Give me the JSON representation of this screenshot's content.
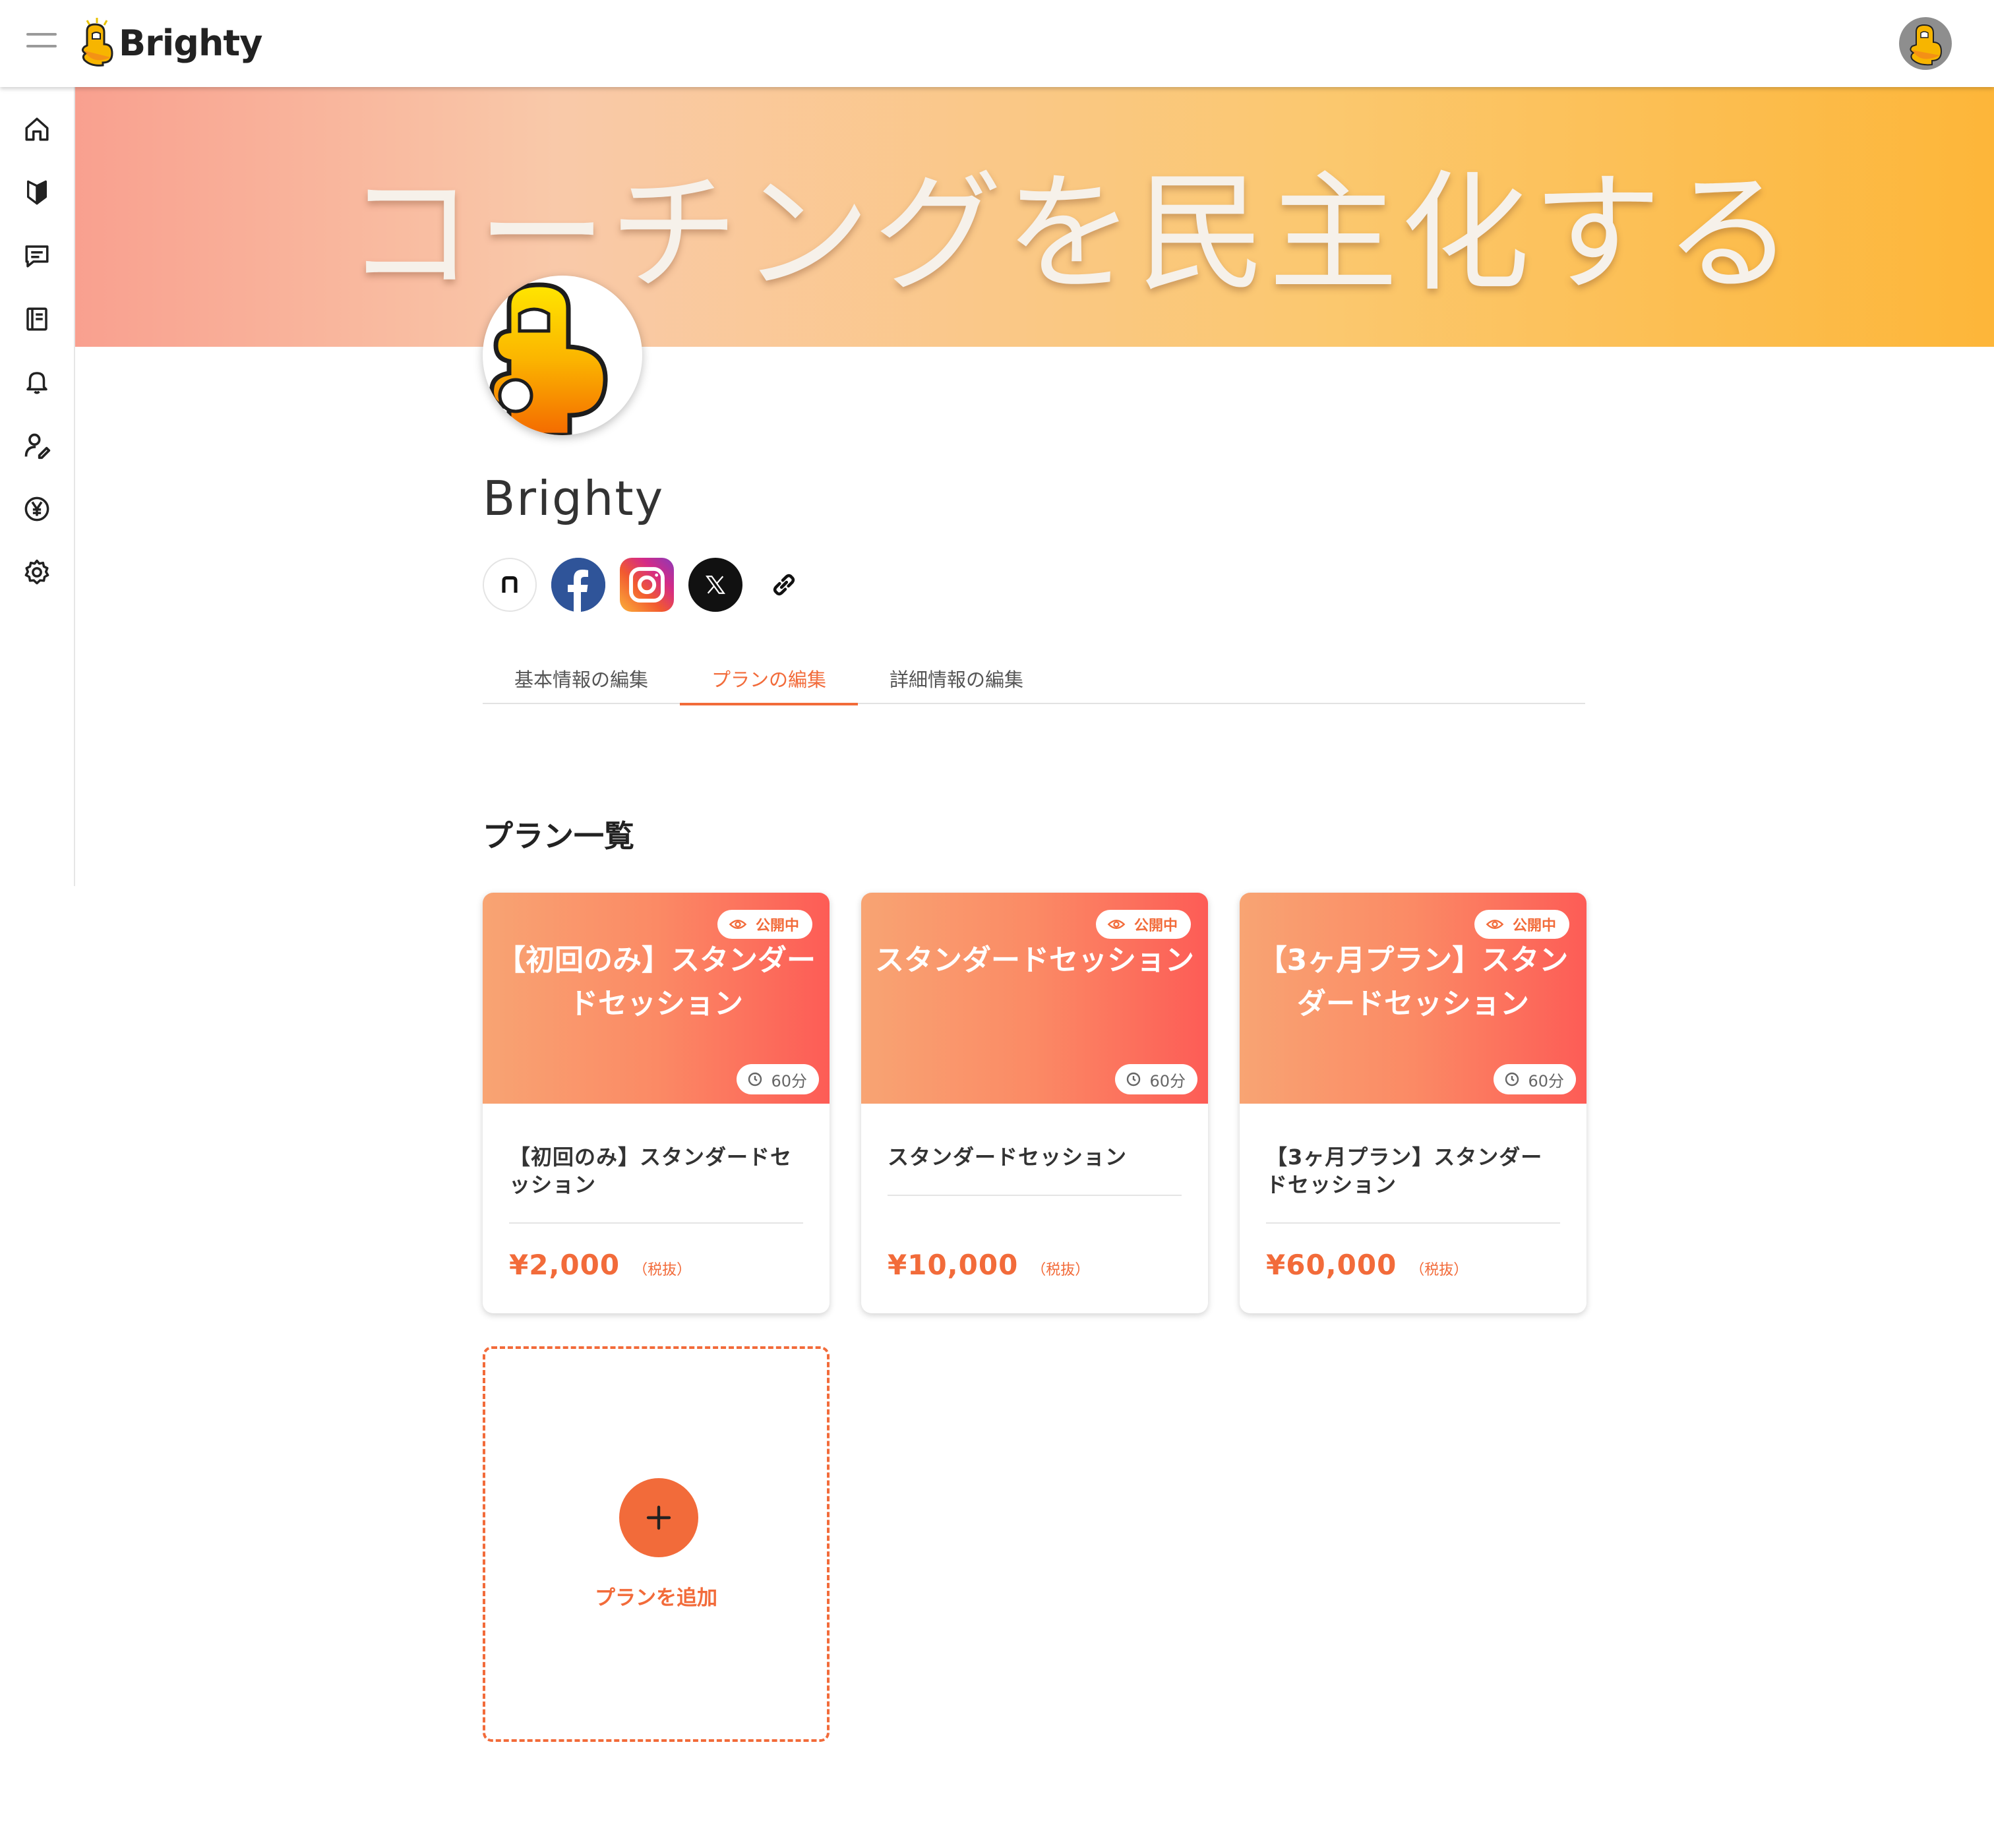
{
  "header": {
    "logo_text": "Brighty",
    "menu_icon": "hamburger-icon",
    "user_avatar": "user-avatar"
  },
  "sidebar": {
    "items": [
      {
        "name": "home",
        "icon": "home-icon"
      },
      {
        "name": "beginner",
        "icon": "beginner-mark-icon"
      },
      {
        "name": "messages",
        "icon": "chat-icon"
      },
      {
        "name": "notebook",
        "icon": "notebook-icon"
      },
      {
        "name": "notifications",
        "icon": "bell-icon"
      },
      {
        "name": "profile-edit",
        "icon": "user-edit-icon"
      },
      {
        "name": "payments",
        "icon": "yen-icon"
      },
      {
        "name": "settings",
        "icon": "gear-icon"
      }
    ]
  },
  "banner": {
    "text": "コーチングを民主化する"
  },
  "profile": {
    "name": "Brighty",
    "socials": [
      "note-icon",
      "facebook-icon",
      "instagram-icon",
      "x-icon",
      "link-icon"
    ]
  },
  "tabs": [
    {
      "label": "基本情報の編集",
      "active": false
    },
    {
      "label": "プランの編集",
      "active": true
    },
    {
      "label": "詳細情報の編集",
      "active": false
    }
  ],
  "plans_section": {
    "title": "プラン一覧",
    "plans": [
      {
        "banner_title": "【初回のみ】スタンダードセッション",
        "status": "公開中",
        "duration": "60分",
        "title": "【初回のみ】スタンダードセッション",
        "price": "¥2,000",
        "tax_note": "（税抜）"
      },
      {
        "banner_title": "スタンダードセッション",
        "status": "公開中",
        "duration": "60分",
        "title": "スタンダードセッション",
        "price": "¥10,000",
        "tax_note": "（税抜）"
      },
      {
        "banner_title": "【3ヶ月プラン】スタンダードセッション",
        "status": "公開中",
        "duration": "60分",
        "title": "【3ヶ月プラン】スタンダードセッション",
        "price": "¥60,000",
        "tax_note": "（税抜）"
      }
    ],
    "add_label": "プランを追加"
  },
  "colors": {
    "accent": "#f26b3a",
    "banner_start": "#f9a08f",
    "banner_end": "#fdb639"
  }
}
